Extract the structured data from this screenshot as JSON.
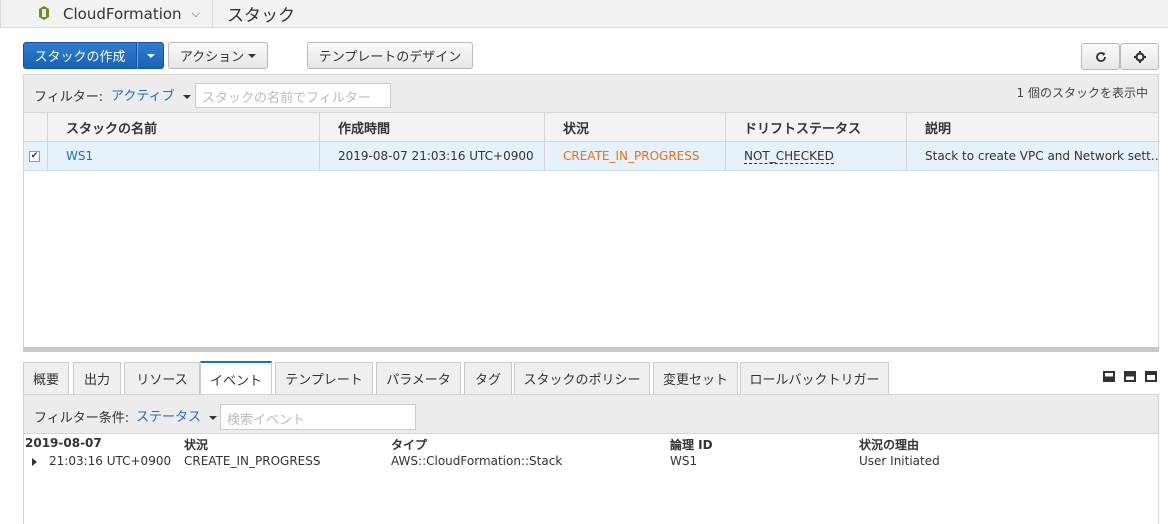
{
  "topbar": {
    "service": "CloudFormation",
    "breadcrumb": "スタック"
  },
  "toolbar": {
    "create_stack": "スタックの作成",
    "actions": "アクション",
    "template_design": "テンプレートのデザイン"
  },
  "filter": {
    "label": "フィルター:",
    "value": "アクティブ",
    "placeholder": "スタックの名前でフィルター",
    "count_text": "1 個のスタックを表示中"
  },
  "grid": {
    "headers": [
      "スタックの名前",
      "作成時間",
      "状況",
      "ドリフトステータス",
      "説明"
    ],
    "rows": [
      {
        "name": "WS1",
        "created": "2019-08-07 21:03:16 UTC+0900",
        "status": "CREATE_IN_PROGRESS",
        "drift": "NOT_CHECKED",
        "description": "Stack to create VPC and Network sett…"
      }
    ]
  },
  "tabs": [
    "概要",
    "出力",
    "リソース",
    "イベント",
    "テンプレート",
    "パラメータ",
    "タグ",
    "スタックのポリシー",
    "変更セット",
    "ロールバックトリガー"
  ],
  "active_tab": "イベント",
  "events": {
    "filter_label": "フィルター条件:",
    "filter_value": "ステータス",
    "search_placeholder": "検索イベント",
    "headers": {
      "date": "2019-08-07",
      "status": "状況",
      "type": "タイプ",
      "logical_id": "論理 ID",
      "reason": "状況の理由"
    },
    "rows": [
      {
        "time": "21:03:16 UTC+0900",
        "status": "CREATE_IN_PROGRESS",
        "type": "AWS::CloudFormation::Stack",
        "logical_id": "WS1",
        "reason": "User Initiated"
      }
    ]
  },
  "colors": {
    "primary": "#1a6fc8",
    "status_progress": "#ec7211",
    "selected_row": "#e5f1fb"
  },
  "icons": [
    "cloudformation-logo-icon",
    "chevron-down-icon",
    "refresh-icon",
    "gear-icon",
    "checkbox-checked-icon",
    "expand-row-icon",
    "layout-icons"
  ]
}
